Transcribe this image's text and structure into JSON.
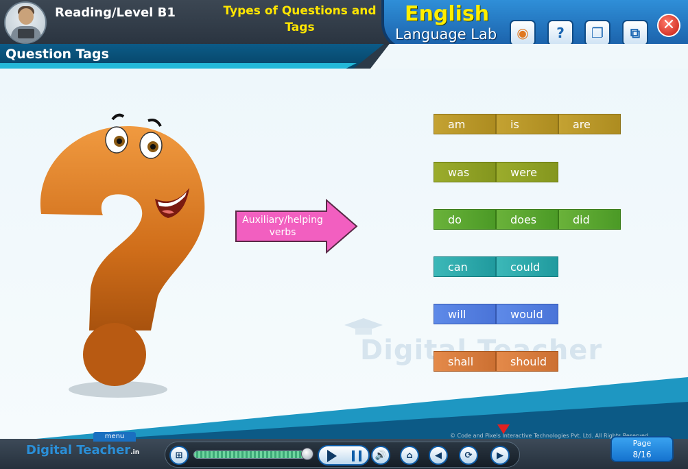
{
  "header": {
    "level_title": "Reading/Level B1",
    "topic_title": "Types of Questions and Tags",
    "lab_title": "English",
    "lab_subtitle": "Language Lab"
  },
  "toolbar": {
    "buttons": [
      {
        "name": "glossary-button",
        "icon": "book-face-icon",
        "glyph": "◉"
      },
      {
        "name": "help-button",
        "icon": "question-icon",
        "glyph": "?"
      },
      {
        "name": "notes-button",
        "icon": "open-book-icon",
        "glyph": "❐"
      },
      {
        "name": "window-button",
        "icon": "windows-icon",
        "glyph": "⧉"
      }
    ],
    "close_glyph": "✕"
  },
  "section": {
    "title": "Question Tags"
  },
  "arrow": {
    "text": "Auxiliary/helping verbs"
  },
  "verb_rows": [
    [
      "am",
      "is",
      "are"
    ],
    [
      "was",
      "were"
    ],
    [
      "do",
      "does",
      "did"
    ],
    [
      "can",
      "could"
    ],
    [
      "will",
      "would"
    ],
    [
      "shall",
      "should"
    ]
  ],
  "watermark": "Digital Teacher",
  "footer": {
    "brand_part1": "Digital",
    "brand_part2": "Teacher",
    "brand_tld": ".in",
    "menu_label": "menu",
    "copyright": "© Code and Pixels Interactive Technologies Pvt. Ltd. All Rights Reserved",
    "page_label": "Page",
    "page_number": "8/16",
    "progress": 0.95
  },
  "colors": {
    "accent_yellow": "#ffe600",
    "lab_blue": "#1a5fa8",
    "question_orange": "#e07820"
  }
}
